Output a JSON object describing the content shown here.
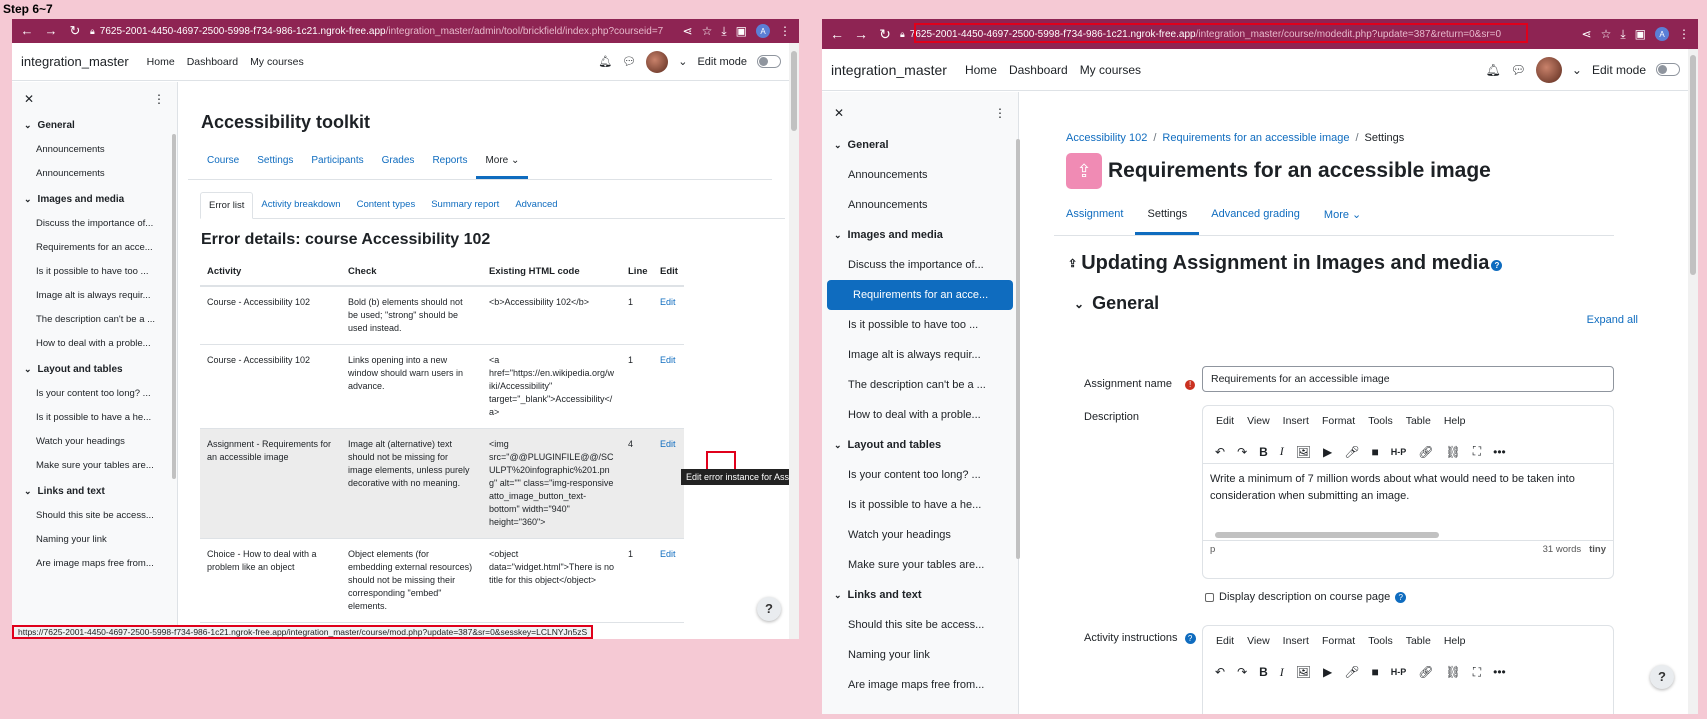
{
  "step_label": "Step 6~7",
  "left": {
    "url_host": "7625-2001-4450-4697-2500-5998-f734-986-1c21.ngrok-free.app",
    "url_path": "/integration_master/admin/tool/brickfield/index.php?courseid=7",
    "avatar_letter": "A",
    "brand": "integration_master",
    "nav": [
      "Home",
      "Dashboard",
      "My courses"
    ],
    "edit_mode": "Edit mode",
    "drawer": [
      {
        "type": "sec",
        "label": "General"
      },
      {
        "type": "itm",
        "label": "Announcements"
      },
      {
        "type": "itm",
        "label": "Announcements"
      },
      {
        "type": "sec",
        "label": "Images and media"
      },
      {
        "type": "itm",
        "label": "Discuss the importance of..."
      },
      {
        "type": "itm",
        "label": "Requirements for an acce..."
      },
      {
        "type": "itm",
        "label": "Is it possible to have too ..."
      },
      {
        "type": "itm",
        "label": "Image alt is always requir..."
      },
      {
        "type": "itm",
        "label": "The description can't be a ..."
      },
      {
        "type": "itm",
        "label": "How to deal with a proble..."
      },
      {
        "type": "sec",
        "label": "Layout and tables"
      },
      {
        "type": "itm",
        "label": "Is your content too long? ..."
      },
      {
        "type": "itm",
        "label": "Is it possible to have a he..."
      },
      {
        "type": "itm",
        "label": "Watch your headings"
      },
      {
        "type": "itm",
        "label": "Make sure your tables are..."
      },
      {
        "type": "sec",
        "label": "Links and text"
      },
      {
        "type": "itm",
        "label": "Should this site be access..."
      },
      {
        "type": "itm",
        "label": "Naming your link"
      },
      {
        "type": "itm",
        "label": "Are image maps free from..."
      }
    ],
    "page_title": "Accessibility toolkit",
    "tabs": [
      "Course",
      "Settings",
      "Participants",
      "Grades",
      "Reports",
      "More ⌄"
    ],
    "subtabs": [
      "Error list",
      "Activity breakdown",
      "Content types",
      "Summary report",
      "Advanced"
    ],
    "error_heading": "Error details: course Accessibility 102",
    "table_headers": [
      "Activity",
      "Check",
      "Existing HTML code",
      "Line",
      "Edit"
    ],
    "rows": [
      {
        "activity": "Course - Accessibility 102",
        "check": "Bold (b) elements should not be used; \"strong\" should be used instead.",
        "code": "<b>Accessibility 102</b>",
        "line": "1",
        "edit": "Edit"
      },
      {
        "activity": "Course - Accessibility 102",
        "check": "Links opening into a new window should warn users in advance.",
        "code": "<a href=\"https://en.wikipedia.org/wiki/Accessibility\" target=\"_blank\">Accessibility</a>",
        "line": "1",
        "edit": "Edit"
      },
      {
        "activity": "Assignment - Requirements for an accessible image",
        "check": "Image alt (alternative) text should not be missing for image elements, unless purely decorative with no meaning.",
        "code": "<img src=\"@@PLUGINFILE@@/SCULPT%20infographic%201.png\" alt=\"\" class=\"img-responsive atto_image_button_text-bottom\" width=\"940\" height=\"360\">",
        "line": "4",
        "edit": "Edit"
      },
      {
        "activity": "Choice - How to deal with a problem like an object",
        "check": "Object elements (for embedding external resources) should not be missing their corresponding \"embed\" elements.",
        "code": "<object data=\"widget.html\">There is no title for this object</object>",
        "line": "1",
        "edit": "Edit"
      }
    ],
    "tooltip": "Edit error instance for Ass",
    "status_url": "https://7625-2001-4450-4697-2500-5998-f734-986-1c21.ngrok-free.app/integration_master/course/mod.php?update=387&sr=0&sesskey=LCLNYJn5zS",
    "help": "?"
  },
  "right": {
    "url_host": "7625-2001-4450-4697-2500-5998-f734-986-1c21.ngrok-free.app",
    "url_path": "/integration_master/course/modedit.php?update=387&return=0&sr=0",
    "avatar_letter": "A",
    "brand": "integration_master",
    "nav": [
      "Home",
      "Dashboard",
      "My courses"
    ],
    "edit_mode": "Edit mode",
    "drawer": [
      {
        "type": "sec",
        "label": "General"
      },
      {
        "type": "itm",
        "label": "Announcements"
      },
      {
        "type": "itm",
        "label": "Announcements"
      },
      {
        "type": "sec",
        "label": "Images and media"
      },
      {
        "type": "itm",
        "label": "Discuss the importance of..."
      },
      {
        "type": "itm",
        "label": "Requirements for an acce...",
        "active": true
      },
      {
        "type": "itm",
        "label": "Is it possible to have too ..."
      },
      {
        "type": "itm",
        "label": "Image alt is always requir..."
      },
      {
        "type": "itm",
        "label": "The description can't be a ..."
      },
      {
        "type": "itm",
        "label": "How to deal with a proble..."
      },
      {
        "type": "sec",
        "label": "Layout and tables"
      },
      {
        "type": "itm",
        "label": "Is your content too long? ..."
      },
      {
        "type": "itm",
        "label": "Is it possible to have a he..."
      },
      {
        "type": "itm",
        "label": "Watch your headings"
      },
      {
        "type": "itm",
        "label": "Make sure your tables are..."
      },
      {
        "type": "sec",
        "label": "Links and text"
      },
      {
        "type": "itm",
        "label": "Should this site be access..."
      },
      {
        "type": "itm",
        "label": "Naming your link"
      },
      {
        "type": "itm",
        "label": "Are image maps free from..."
      }
    ],
    "breadcrumb": [
      "Accessibility 102",
      "Requirements for an accessible image",
      "Settings"
    ],
    "page_title": "Requirements for an accessible image",
    "tabs": [
      "Assignment",
      "Settings",
      "Advanced grading",
      "More ⌄"
    ],
    "updating_heading": "Updating Assignment in Images and media",
    "expand_all": "Expand all",
    "section_general": "General",
    "assignment_name_label": "Assignment name",
    "assignment_name_value": "Requirements for an accessible image",
    "description_label": "Description",
    "menu": [
      "Edit",
      "View",
      "Insert",
      "Format",
      "Tools",
      "Table",
      "Help"
    ],
    "description_text": "Write a minimum of 7 million words about what would need to be taken into consideration when submitting an image.",
    "editor_path": "p",
    "word_count": "31 words",
    "tiny": "tiny",
    "display_desc": "Display description on course page",
    "activity_instructions_label": "Activity instructions",
    "help": "?"
  }
}
